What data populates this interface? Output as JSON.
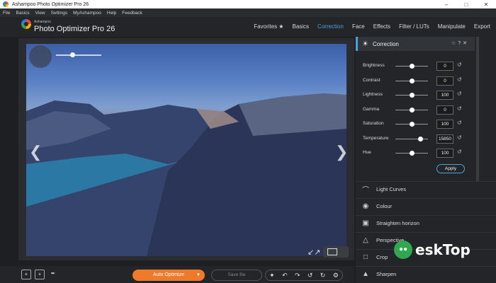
{
  "window": {
    "title": "Ashampoo Photo Optimizer Pro 26"
  },
  "menu": [
    "File",
    "Basics",
    "View",
    "Settings",
    "MyAshampoo",
    "Help",
    "Feedback"
  ],
  "brand": {
    "small": "Ashampoo",
    "big": "Photo Optimizer Pro 26"
  },
  "tabs": [
    {
      "label": "Favorites ★",
      "active": false
    },
    {
      "label": "Basics",
      "active": false
    },
    {
      "label": "Correction",
      "active": true
    },
    {
      "label": "Face",
      "active": false
    },
    {
      "label": "Effects",
      "active": false
    },
    {
      "label": "Filter / LUTs",
      "active": false
    },
    {
      "label": "Manipulate",
      "active": false
    },
    {
      "label": "Export",
      "active": false
    }
  ],
  "panel": {
    "title": "Correction",
    "adjustments": [
      {
        "label": "Brightness",
        "value": "0",
        "level": 0.5
      },
      {
        "label": "Contrast",
        "value": "0",
        "level": 0.5
      },
      {
        "label": "Lightness",
        "value": "100",
        "level": 0.5
      },
      {
        "label": "Gamma",
        "value": "0",
        "level": 0.5
      },
      {
        "label": "Saturation",
        "value": "100",
        "level": 0.5
      },
      {
        "label": "Temperature",
        "value": "15850",
        "level": 0.78
      },
      {
        "label": "Hue",
        "value": "100",
        "level": 0.5
      }
    ],
    "apply_label": "Apply",
    "tools": [
      {
        "label": "Light Curves",
        "icon": "curve-icon"
      },
      {
        "label": "Colour",
        "icon": "palette-icon"
      },
      {
        "label": "Straighten horizon",
        "icon": "image-icon"
      },
      {
        "label": "Perspective",
        "icon": "trapezoid-icon"
      },
      {
        "label": "Crop",
        "icon": "crop-icon"
      },
      {
        "label": "Sharpen",
        "icon": "triangle-icon"
      }
    ]
  },
  "bottom": {
    "auto_optimize": "Auto Optimize",
    "save_file": "Save file"
  },
  "watermark": "eskTop",
  "colors": {
    "accent": "#4aa3df",
    "auto_button": "#f07a2b",
    "background": "#1d1f22"
  }
}
